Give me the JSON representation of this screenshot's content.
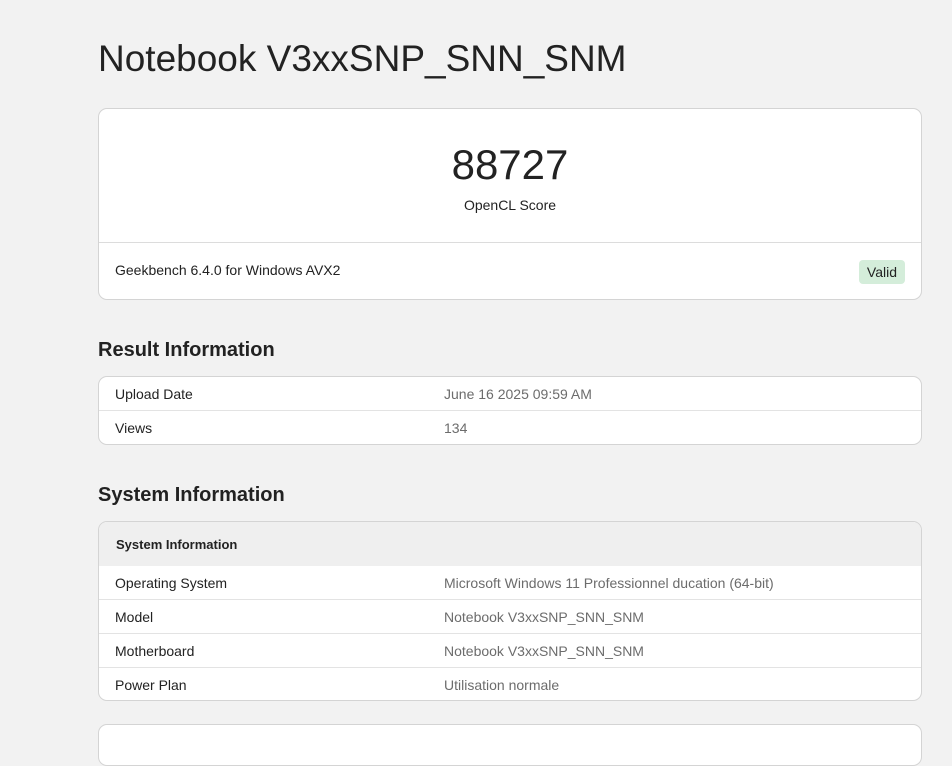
{
  "page_title": "Notebook V3xxSNP_SNN_SNM",
  "score": {
    "value": "88727",
    "label": "OpenCL Score",
    "version": "Geekbench 6.4.0 for Windows AVX2",
    "badge": "Valid",
    "badge_color": "#d4edda"
  },
  "result_info": {
    "heading": "Result Information",
    "rows": [
      {
        "key": "Upload Date",
        "value": "June 16 2025 09:59 AM"
      },
      {
        "key": "Views",
        "value": "134"
      }
    ]
  },
  "system_info": {
    "heading": "System Information",
    "table_header": "System Information",
    "rows": [
      {
        "key": "Operating System",
        "value": "Microsoft Windows 11 Professionnel ducation (64-bit)"
      },
      {
        "key": "Model",
        "value": "Notebook V3xxSNP_SNN_SNM"
      },
      {
        "key": "Motherboard",
        "value": "Notebook V3xxSNP_SNN_SNM"
      },
      {
        "key": "Power Plan",
        "value": "Utilisation normale"
      }
    ]
  }
}
